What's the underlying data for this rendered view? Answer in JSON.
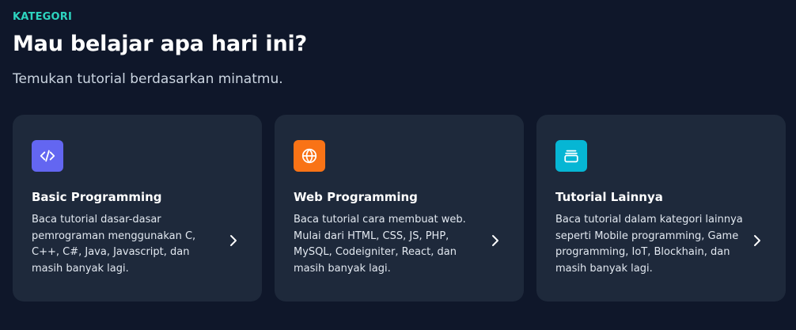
{
  "section": {
    "eyebrow": "KATEGORI",
    "title": "Mau belajar apa hari ini?",
    "subtitle": "Temukan tutorial berdasarkan minatmu."
  },
  "colors": {
    "background": "#0f172a",
    "card": "#1e293b",
    "eyebrow": "#2dd4bf"
  },
  "cards": [
    {
      "title": "Basic Programming",
      "description": "Baca tutorial dasar-dasar pemrograman menggunakan C, C++, C#, Java, Javascript, dan masih banyak lagi.",
      "icon": "code-icon",
      "icon_bg": "#6366f1"
    },
    {
      "title": "Web Programming",
      "description": "Baca tutorial cara membuat web. Mulai dari HTML, CSS, JS, PHP, MySQL, Codeigniter, React, dan masih banyak lagi.",
      "icon": "globe-icon",
      "icon_bg": "#f97316"
    },
    {
      "title": "Tutorial Lainnya",
      "description": "Baca tutorial dalam kategori lainnya seperti Mobile programming, Game programming, IoT, Blockhain, dan masih banyak lagi.",
      "icon": "stack-icon",
      "icon_bg": "#06b6d4"
    }
  ]
}
